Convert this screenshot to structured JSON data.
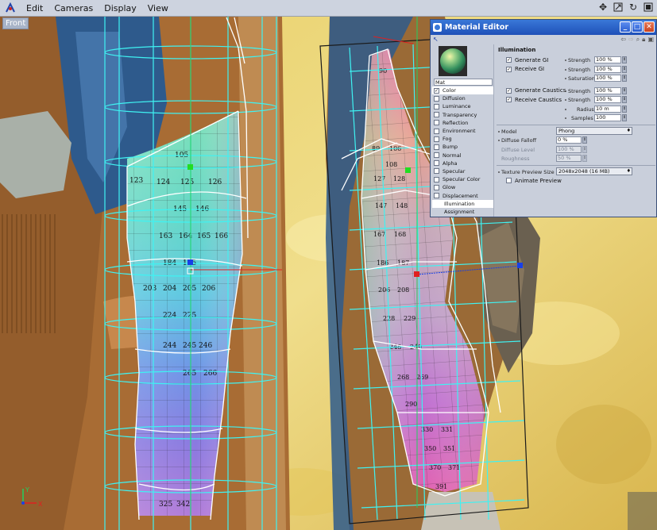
{
  "menu": {
    "items": [
      "Edit",
      "Cameras",
      "Display",
      "View"
    ]
  },
  "viewport": {
    "label": "Front",
    "axis_x": "X",
    "axis_y": "Y"
  },
  "material_editor": {
    "title": "Material Editor",
    "material_name": "Mat",
    "channels": [
      {
        "label": "Color",
        "checked": true
      },
      {
        "label": "Diffusion",
        "checked": false
      },
      {
        "label": "Luminance",
        "checked": false
      },
      {
        "label": "Transparency",
        "checked": false
      },
      {
        "label": "Reflection",
        "checked": false
      },
      {
        "label": "Environment",
        "checked": false
      },
      {
        "label": "Fog",
        "checked": false
      },
      {
        "label": "Bump",
        "checked": false
      },
      {
        "label": "Normal",
        "checked": false
      },
      {
        "label": "Alpha",
        "checked": false
      },
      {
        "label": "Specular",
        "checked": false
      },
      {
        "label": "Specular Color",
        "checked": false
      },
      {
        "label": "Glow",
        "checked": false
      },
      {
        "label": "Displacement",
        "checked": false
      }
    ],
    "extra_items": [
      "Illumination",
      "Assignment"
    ],
    "section": "Illumination",
    "generate_gi": "Generate GI",
    "receive_gi": "Receive GI",
    "strength_label": "Strength",
    "saturation_label": "Saturation",
    "gi_strength": "100 %",
    "gi_receive_strength": "100 %",
    "gi_saturation": "100 %",
    "generate_caustics": "Generate Caustics",
    "receive_caustics": "Receive Caustics",
    "radius_label": "Radius",
    "samples_label": "Samples",
    "caustics_strength": "100 %",
    "caustics_receive_strength": "100 %",
    "radius": "10 m",
    "samples": "100",
    "model_label": "Model",
    "model": "Phong",
    "diffuse_falloff_label": "Diffuse Falloff",
    "diffuse_falloff": "0 %",
    "diffuse_level_label": "Diffuse Level",
    "diffuse_level": "100 %",
    "roughness_label": "Roughness",
    "roughness": "50 %",
    "texture_preview_label": "Texture Preview Size",
    "texture_preview": "2048x2048 (16 MB)",
    "animate_preview": "Animate Preview"
  },
  "uv_numbers_left": [
    "105",
    "123",
    "124",
    "125",
    "126",
    "145",
    "146",
    "163",
    "164",
    "165",
    "166",
    "184",
    "185",
    "203",
    "204",
    "205",
    "206",
    "224",
    "225",
    "244",
    "245",
    "246",
    "265",
    "266",
    "325",
    "342"
  ],
  "uv_numbers_right": [
    "90",
    "89",
    "106",
    "108",
    "127",
    "128",
    "147",
    "148",
    "167",
    "168",
    "186",
    "187",
    "206",
    "208",
    "228",
    "229",
    "248",
    "249",
    "268",
    "269",
    "290",
    "330",
    "331",
    "350",
    "351",
    "370",
    "371",
    "391"
  ],
  "colors": {
    "cyan_cage": "#3ff2f2",
    "axis_red": "#e02020",
    "accent_blue": "#1840e8"
  }
}
